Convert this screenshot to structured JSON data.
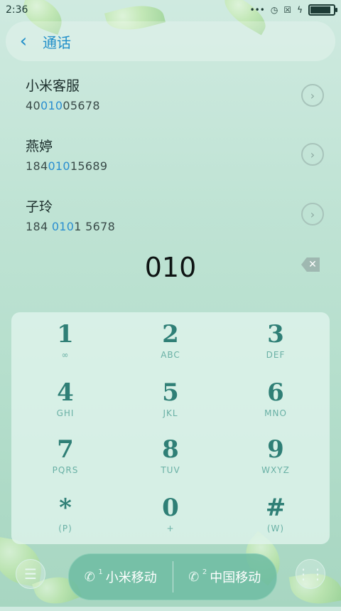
{
  "status": {
    "time": "2:36",
    "icons": [
      "more-icon",
      "alarm-icon",
      "sim-off-icon",
      "charging-icon",
      "battery-icon"
    ]
  },
  "header": {
    "title": "通话"
  },
  "contacts": [
    {
      "name": "小米客服",
      "num_parts": [
        "40",
        "010",
        "05678"
      ]
    },
    {
      "name": "燕婷",
      "num_parts": [
        "184",
        "010",
        "15689"
      ]
    },
    {
      "name": "子玲",
      "num_parts": [
        "184 ",
        "010",
        "1 5678"
      ]
    }
  ],
  "dialed": "010",
  "keypad": [
    {
      "digit": "1",
      "sub": "∞"
    },
    {
      "digit": "2",
      "sub": "ABC"
    },
    {
      "digit": "3",
      "sub": "DEF"
    },
    {
      "digit": "4",
      "sub": "GHI"
    },
    {
      "digit": "5",
      "sub": "JKL"
    },
    {
      "digit": "6",
      "sub": "MNO"
    },
    {
      "digit": "7",
      "sub": "PQRS"
    },
    {
      "digit": "8",
      "sub": "TUV"
    },
    {
      "digit": "9",
      "sub": "WXYZ"
    },
    {
      "digit": "*",
      "sub": "(P)"
    },
    {
      "digit": "0",
      "sub": "+"
    },
    {
      "digit": "#",
      "sub": "(W)"
    }
  ],
  "call_bar": {
    "sim1_label": "小米移动",
    "sim2_label": "中国移动"
  }
}
